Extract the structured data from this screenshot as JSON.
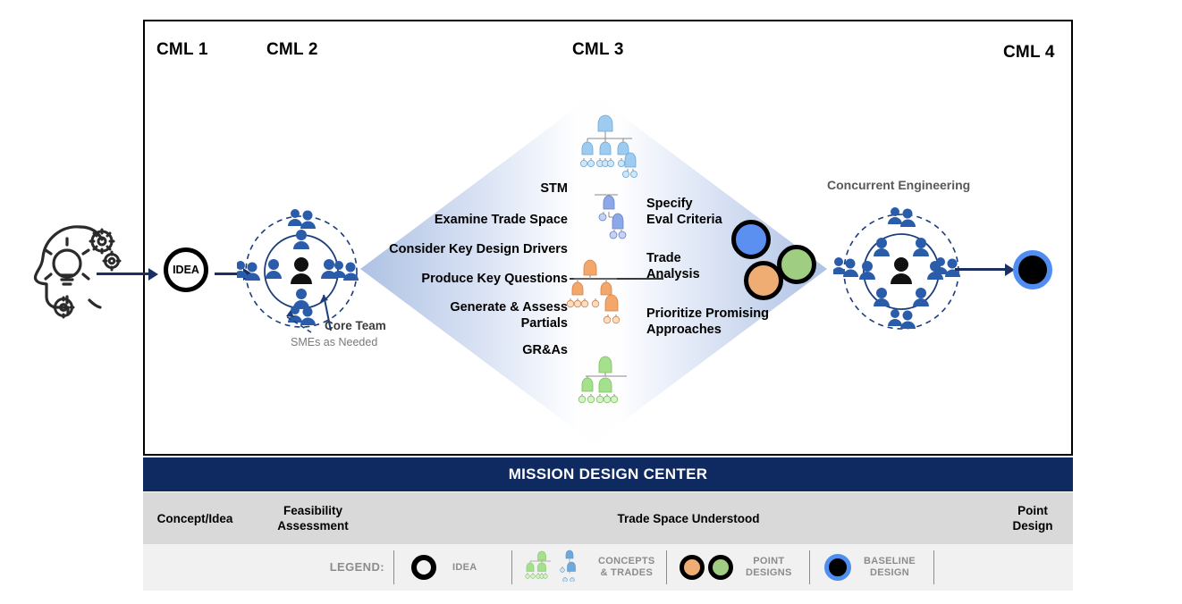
{
  "headers": {
    "cml1": "CML 1",
    "cml2": "CML 2",
    "cml3": "CML 3",
    "cml4": "CML 4"
  },
  "idea": {
    "label": "IDEA"
  },
  "team": {
    "core_label": "Core Team",
    "sme_label": "SMEs as Needed"
  },
  "diamond": {
    "left_labels": [
      "STM",
      "Examine Trade Space",
      "Consider Key Design Drivers",
      "Produce Key Questions",
      "Generate & Assess",
      "Partials",
      "GR&As"
    ],
    "right_labels": [
      "Specify",
      "Eval Criteria",
      "Trade",
      "Analysis",
      "Prioritize Promising",
      "Approaches"
    ]
  },
  "concurrent_engineering": {
    "title": "Concurrent Engineering"
  },
  "mdc_band": {
    "title": "MISSION DESIGN CENTER"
  },
  "stages": [
    {
      "label": "Concept/Idea"
    },
    {
      "label": "Feasibility\nAssessment"
    },
    {
      "label": "Trade Space Understood"
    },
    {
      "label": "Point\nDesign"
    }
  ],
  "legend": {
    "word": "LEGEND:",
    "items": [
      {
        "label": "IDEA",
        "icon": "idea-ring-icon"
      },
      {
        "label": "CONCEPTS\n& TRADES",
        "icon": "concept-tree-icon"
      },
      {
        "label": "POINT\nDESIGNS",
        "icon": "point-design-circles-icon"
      },
      {
        "label": "BASELINE\nDESIGN",
        "icon": "baseline-design-icon"
      }
    ]
  },
  "colors": {
    "navy": "#0e2a60",
    "arrow": "#1b2f63",
    "team_blue": "#2a5caa",
    "diamond_edge": "#aec2e4",
    "diamond_center": "#fbfcfe",
    "blue_point": "#5b8ff0",
    "green_point": "#9fce82",
    "orange_point": "#f0ad73",
    "baseline_ring": "#4f8ef0",
    "band_gray": "#d9d9d9",
    "legend_gray": "#f1f1f1",
    "legend_text": "#8c8c8c"
  }
}
